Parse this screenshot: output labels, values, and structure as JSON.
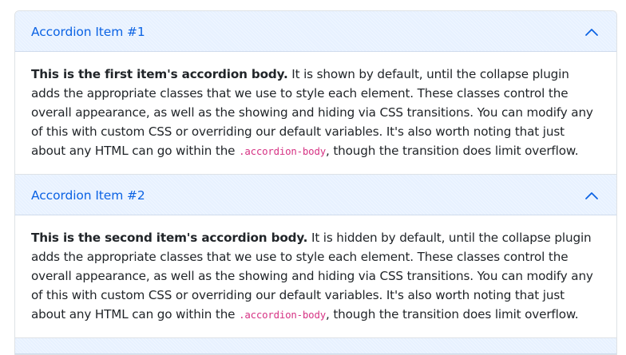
{
  "accordion": {
    "items": [
      {
        "title": "Accordion Item #1",
        "body_lead": "This is the first item's accordion body.",
        "body_text": " It is shown by default, until the collapse plugin adds the appropriate classes that we use to style each element. These classes control the overall appearance, as well as the showing and hiding via CSS transitions. You can modify any of this with custom CSS or overriding our default variables. It's also worth noting that just about any HTML can go within the ",
        "body_code": ".accordion-body",
        "body_tail": ", though the transition does limit overflow."
      },
      {
        "title": "Accordion Item #2",
        "body_lead": "This is the second item's accordion body.",
        "body_text": " It is hidden by default, until the collapse plugin adds the appropriate classes that we use to style each element. These classes control the overall appearance, as well as the showing and hiding via CSS transitions. You can modify any of this with custom CSS or overriding our default variables. It's also worth noting that just about any HTML can go within the ",
        "body_code": ".accordion-body",
        "body_tail": ", though the transition does limit overflow."
      }
    ],
    "header_icon": "chevron-up-icon",
    "colors": {
      "header_bg": "#e7f1ff",
      "title": "#0c63e4",
      "code": "#d63384",
      "border": "#dee2e6"
    }
  }
}
